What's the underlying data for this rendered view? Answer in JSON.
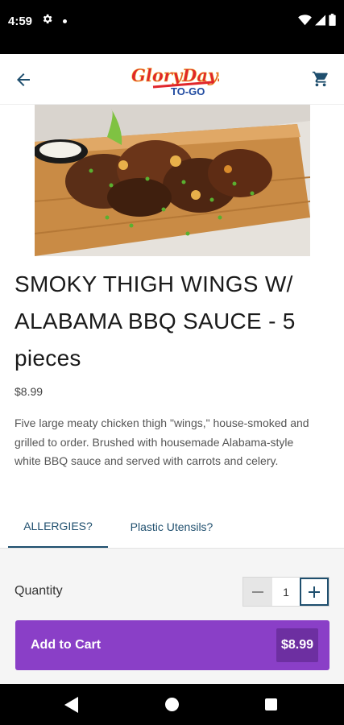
{
  "status_bar": {
    "time": "4:59"
  },
  "header": {
    "logo_main": "GloryDays",
    "logo_sub": "TO-GO"
  },
  "product": {
    "title": "SMOKY THIGH WINGS W/ ALABAMA BBQ SAUCE - 5 pieces",
    "price": "$8.99",
    "description": "Five large meaty chicken thigh \"wings,\" house-smoked and grilled to order. Brushed with housemade Alabama-style white BBQ sauce and served with carrots and celery."
  },
  "tabs": [
    {
      "label": "ALLERGIES?",
      "active": true
    },
    {
      "label": "Plastic Utensils?",
      "active": false
    }
  ],
  "quantity": {
    "label": "Quantity",
    "value": "1"
  },
  "cart_button": {
    "label": "Add to Cart",
    "price": "$8.99"
  },
  "colors": {
    "accent": "#1f4f6e",
    "cta": "#8a3fc7",
    "cta_price_bg": "#6d2fa1"
  },
  "icons": [
    "gear-icon",
    "wifi-icon",
    "signal-icon",
    "battery-icon",
    "back-arrow-icon",
    "cart-icon",
    "minus-icon",
    "plus-icon",
    "nav-back-icon",
    "nav-home-icon",
    "nav-recents-icon"
  ]
}
